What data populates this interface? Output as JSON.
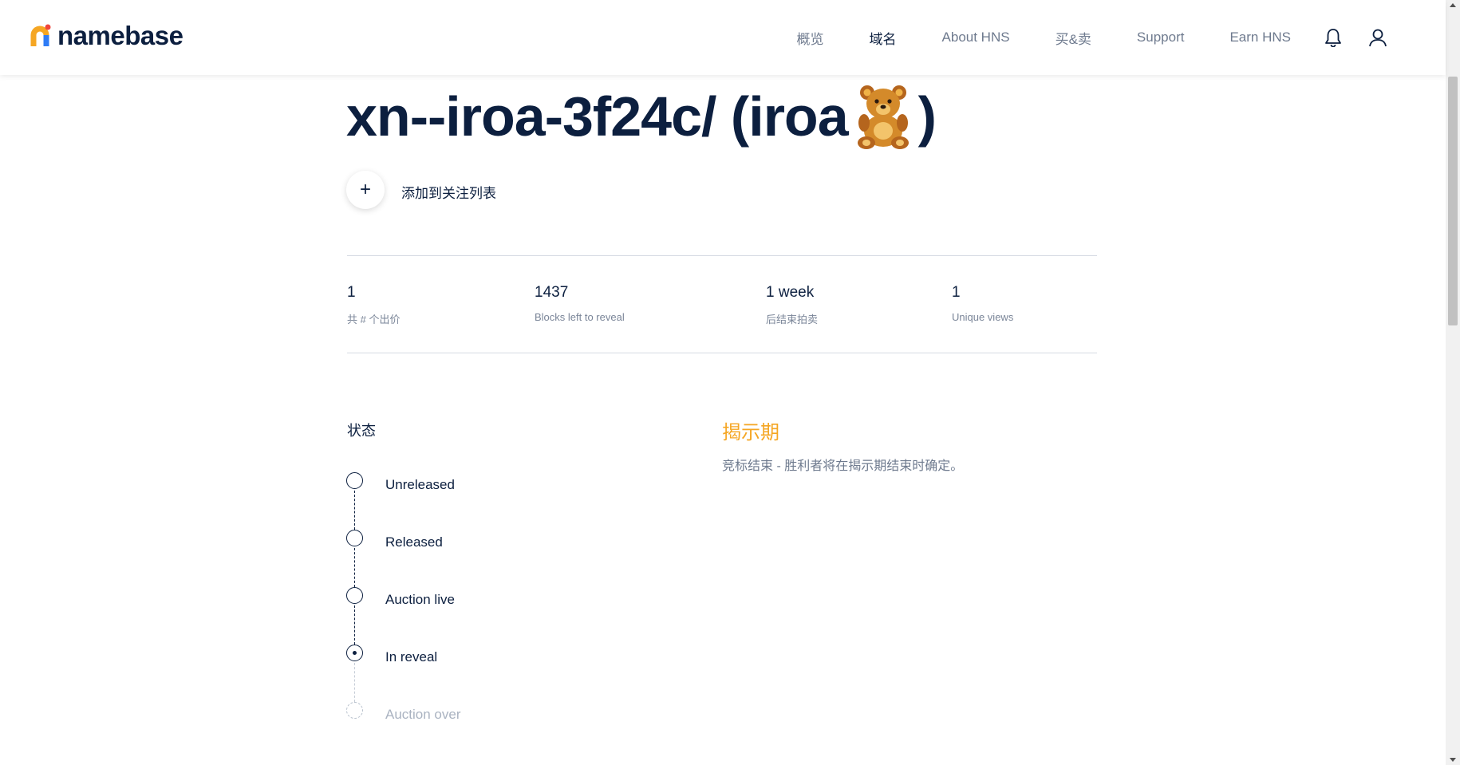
{
  "header": {
    "logo_text": "namebase",
    "nav": [
      "概览",
      "域名",
      "About HNS",
      "买&卖",
      "Support",
      "Earn HNS"
    ],
    "active_index": 1
  },
  "domain": {
    "title": "xn--iroa-3f24c/ (iroa",
    "title_suffix": ")",
    "emoji_icon": "teddy-bear-icon"
  },
  "watchlist": {
    "button_symbol": "+",
    "label": "添加到关注列表"
  },
  "stats": [
    {
      "value": "1",
      "label": "共 # 个出价"
    },
    {
      "value": "1437",
      "label": "Blocks left to reveal"
    },
    {
      "value": "1 week",
      "label": "后结束拍卖"
    },
    {
      "value": "1",
      "label": "Unique views"
    }
  ],
  "status": {
    "heading": "状态",
    "steps": [
      "Unreleased",
      "Released",
      "Auction live",
      "In reveal",
      "Auction over"
    ],
    "current_step": "In reveal"
  },
  "phase": {
    "title": "揭示期",
    "description": "竞标结束 - 胜利者将在揭示期结束时确定。"
  },
  "colors": {
    "primary": "#0c1f3f",
    "accent": "#f5a623",
    "muted": "#6e7a8e"
  }
}
